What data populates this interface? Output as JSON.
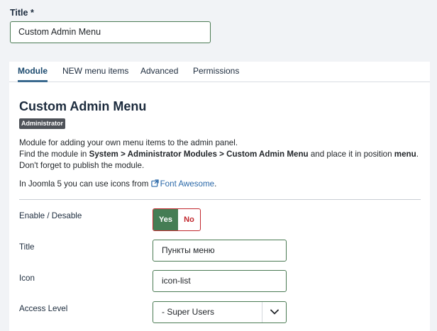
{
  "form": {
    "title_label": "Title *",
    "title_value": "Custom Admin Menu"
  },
  "tabs": [
    {
      "label": "Module",
      "active": true
    },
    {
      "label": "NEW menu items",
      "active": false
    },
    {
      "label": "Advanced",
      "active": false
    },
    {
      "label": "Permissions",
      "active": false
    }
  ],
  "module": {
    "heading": "Custom Admin Menu",
    "badge": "Administrator",
    "desc_line1": "Module for adding your own menu items to the admin panel.",
    "desc_find_prefix": "Find the module in ",
    "desc_find_path": "System > Administrator Modules > Custom Admin Menu",
    "desc_find_middle": " and place it in position ",
    "desc_position": "menu",
    "desc_find_suffix": ". Don't forget to publish the module.",
    "icons_prefix": "In Joomla 5 you can use icons from ",
    "icons_link": "Font Awesome",
    "icons_suffix": "."
  },
  "fields": {
    "enable_label": "Enable / Desable",
    "enable_yes": "Yes",
    "enable_no": "No",
    "enable_selected": "Yes",
    "title_label": "Title",
    "title_value": "Пункты меню",
    "icon_label": "Icon",
    "icon_value": "icon-list",
    "access_label": "Access Level",
    "access_value": "- Super Users"
  },
  "colors": {
    "accent_green": "#457d54",
    "danger_red": "#c1272d",
    "link_blue": "#2a68a8",
    "active_tab": "#1c4a6e"
  },
  "icons": {
    "external_link": "external-link-icon",
    "select_arrow": "chevron-down-icon"
  }
}
